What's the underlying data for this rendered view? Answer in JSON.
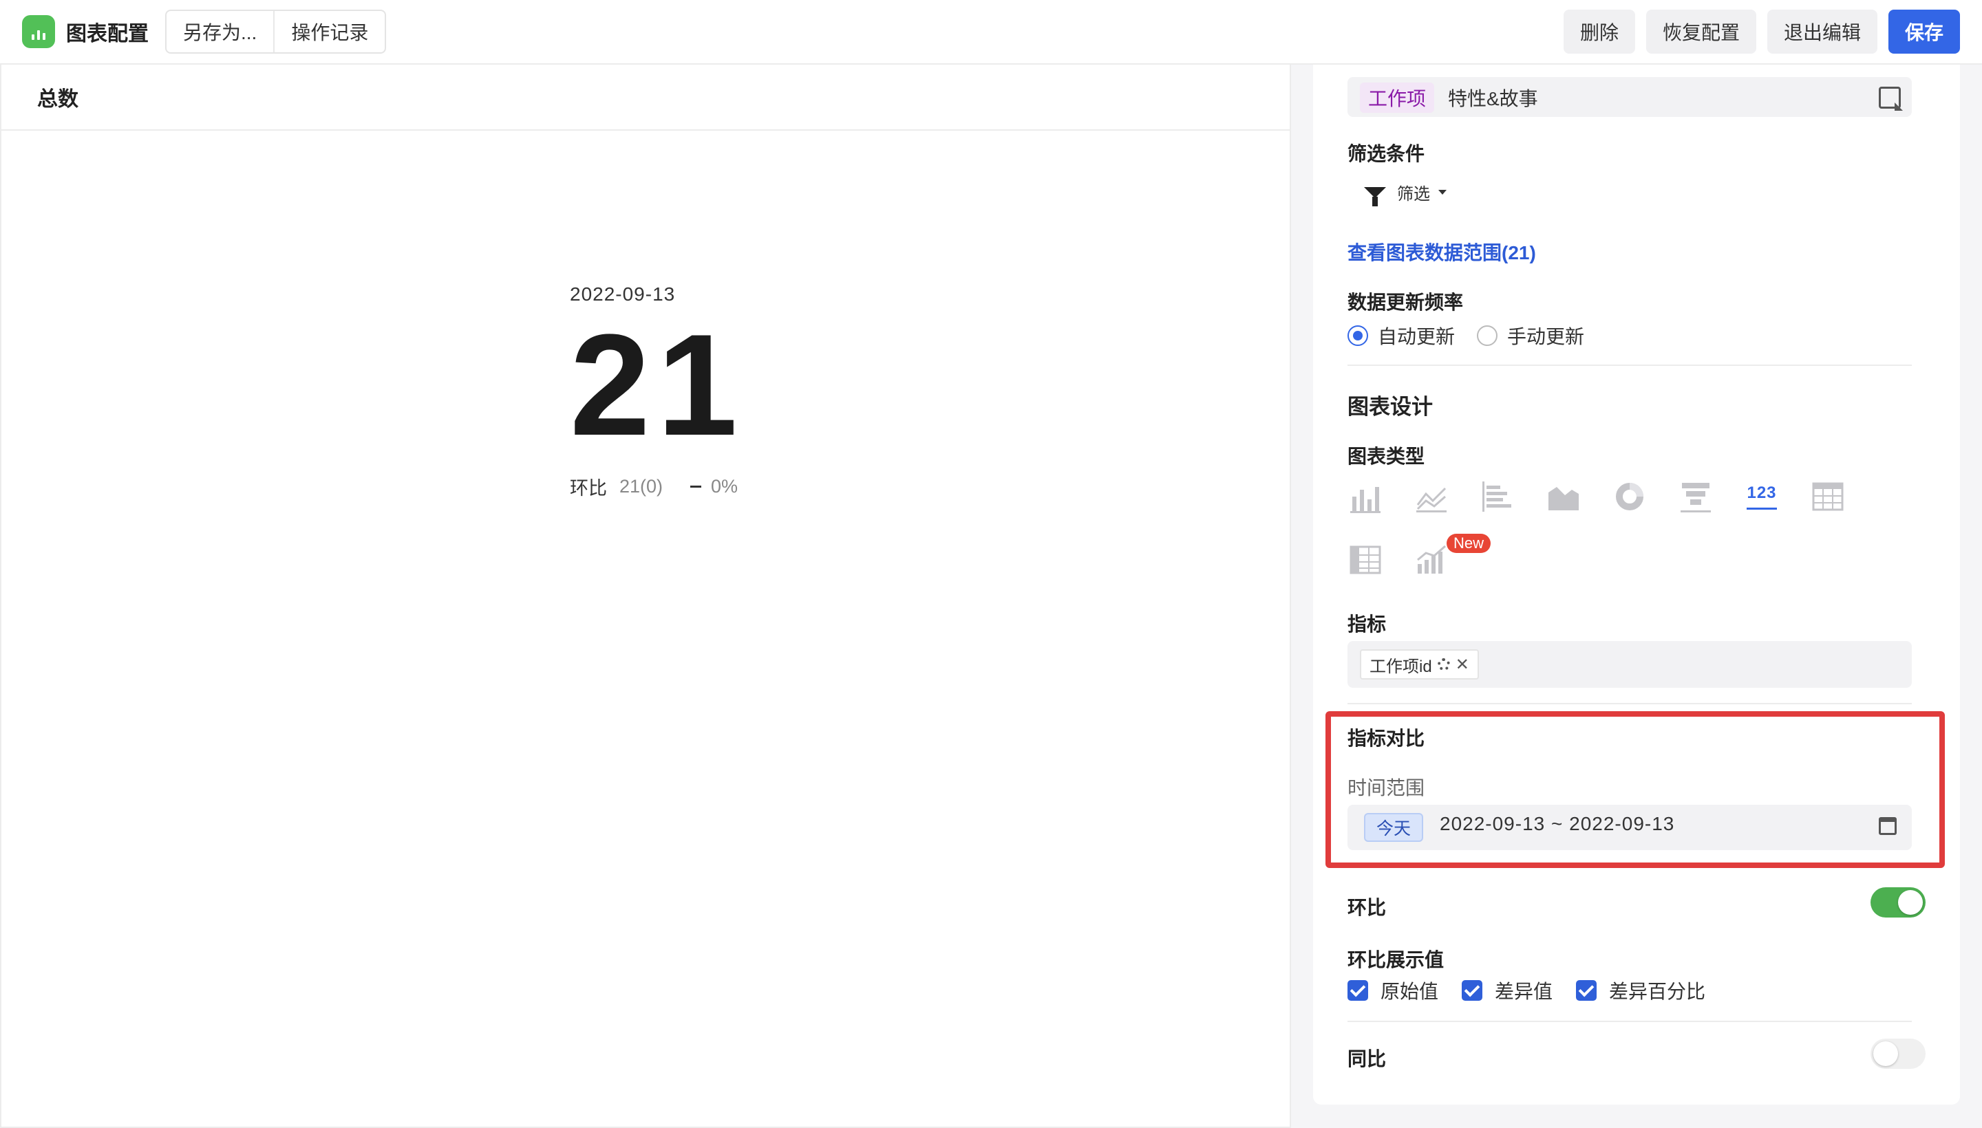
{
  "header": {
    "title": "图表配置",
    "save_as": "另存为...",
    "history": "操作记录",
    "delete": "删除",
    "restore": "恢复配置",
    "exit_edit": "退出编辑",
    "save": "保存"
  },
  "left": {
    "panel_title": "总数",
    "metric_date": "2022-09-13",
    "metric_value": "21",
    "compare_label": "环比",
    "compare_value": "21(0)",
    "compare_pct": "0%"
  },
  "right": {
    "data_source": {
      "tag": "工作项",
      "value": "特性&故事"
    },
    "filter": {
      "label": "筛选条件",
      "button": "筛选"
    },
    "view_range_link": "查看图表数据范围(21)",
    "update_freq": {
      "label": "数据更新频率",
      "options": [
        "自动更新",
        "手动更新"
      ],
      "selected": "自动更新"
    },
    "design_title": "图表设计",
    "chart_type": {
      "label": "图表类型",
      "icons": [
        "bar-chart-icon",
        "line-chart-icon",
        "horizontal-bar-icon",
        "area-chart-icon",
        "donut-chart-icon",
        "funnel-chart-icon",
        "number-card-icon",
        "table-icon",
        "pivot-table-icon",
        "combo-chart-icon"
      ],
      "new_badge": "New",
      "number_icon_text": "123"
    },
    "metric": {
      "label": "指标",
      "tag": "工作项id"
    },
    "metric_compare": {
      "label": "指标对比",
      "time_range_label": "时间范围",
      "today_tag": "今天",
      "date_range": "2022-09-13 ~ 2022-09-13"
    },
    "mom": {
      "label": "环比",
      "enabled": true
    },
    "mom_display": {
      "label": "环比展示值",
      "options": [
        "原始值",
        "差异值",
        "差异百分比"
      ]
    },
    "yoy": {
      "label": "同比",
      "enabled": false
    }
  },
  "colors": {
    "primary": "#3366e6",
    "highlight": "#e03c3c",
    "toggle_on": "#4caf50",
    "app_icon": "#52c057"
  }
}
